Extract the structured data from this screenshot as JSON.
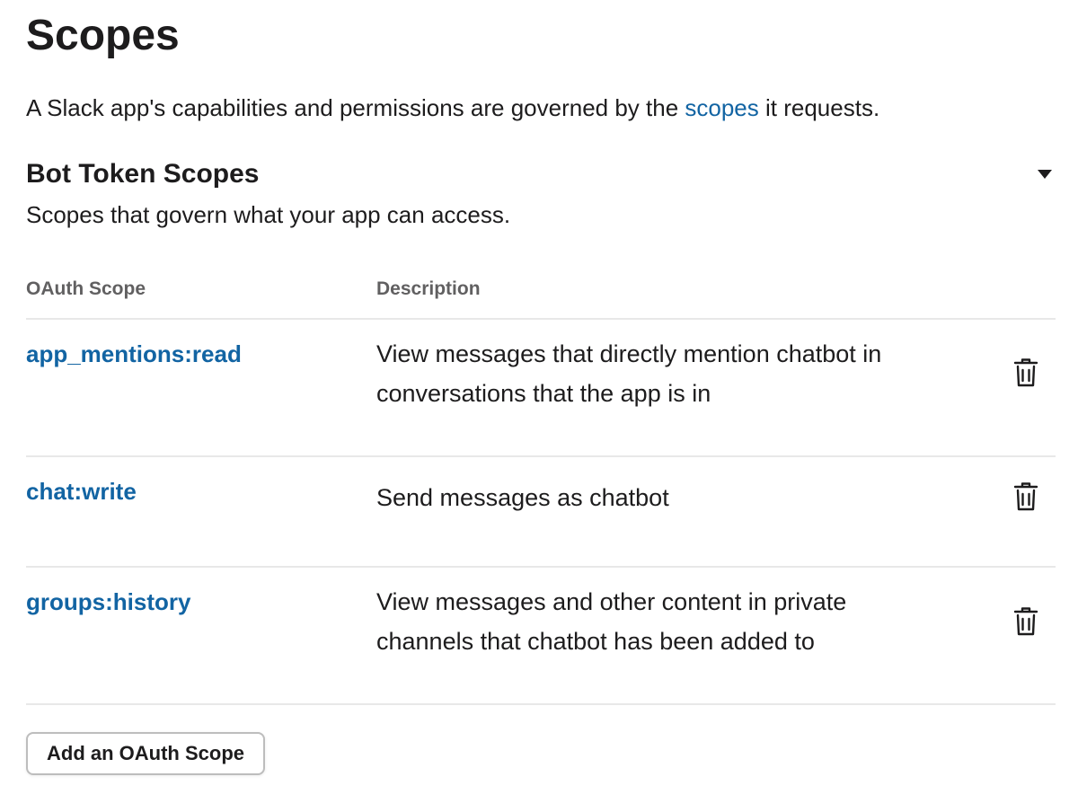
{
  "page": {
    "title": "Scopes",
    "intro_before": "A Slack app's capabilities and permissions are governed by the ",
    "intro_link": "scopes",
    "intro_after": " it requests."
  },
  "section": {
    "title": "Bot Token Scopes",
    "subtitle": "Scopes that govern what your app can access.",
    "toggle_icon": "caret-down-icon"
  },
  "table": {
    "columns": [
      "OAuth Scope",
      "Description"
    ],
    "rows": [
      {
        "scope": "app_mentions:read",
        "description": "View messages that directly mention chatbot in conversations that the app is in",
        "action_icon": "trash-icon"
      },
      {
        "scope": "chat:write",
        "description": "Send messages as chatbot",
        "action_icon": "trash-icon"
      },
      {
        "scope": "groups:history",
        "description": "View messages and other content in private channels that chatbot has been added to",
        "action_icon": "trash-icon"
      }
    ]
  },
  "actions": {
    "add_scope_label": "Add an OAuth Scope"
  },
  "colors": {
    "link": "#1264a3",
    "text": "#1d1c1d",
    "muted": "#616061",
    "divider": "#e8e8e8"
  }
}
